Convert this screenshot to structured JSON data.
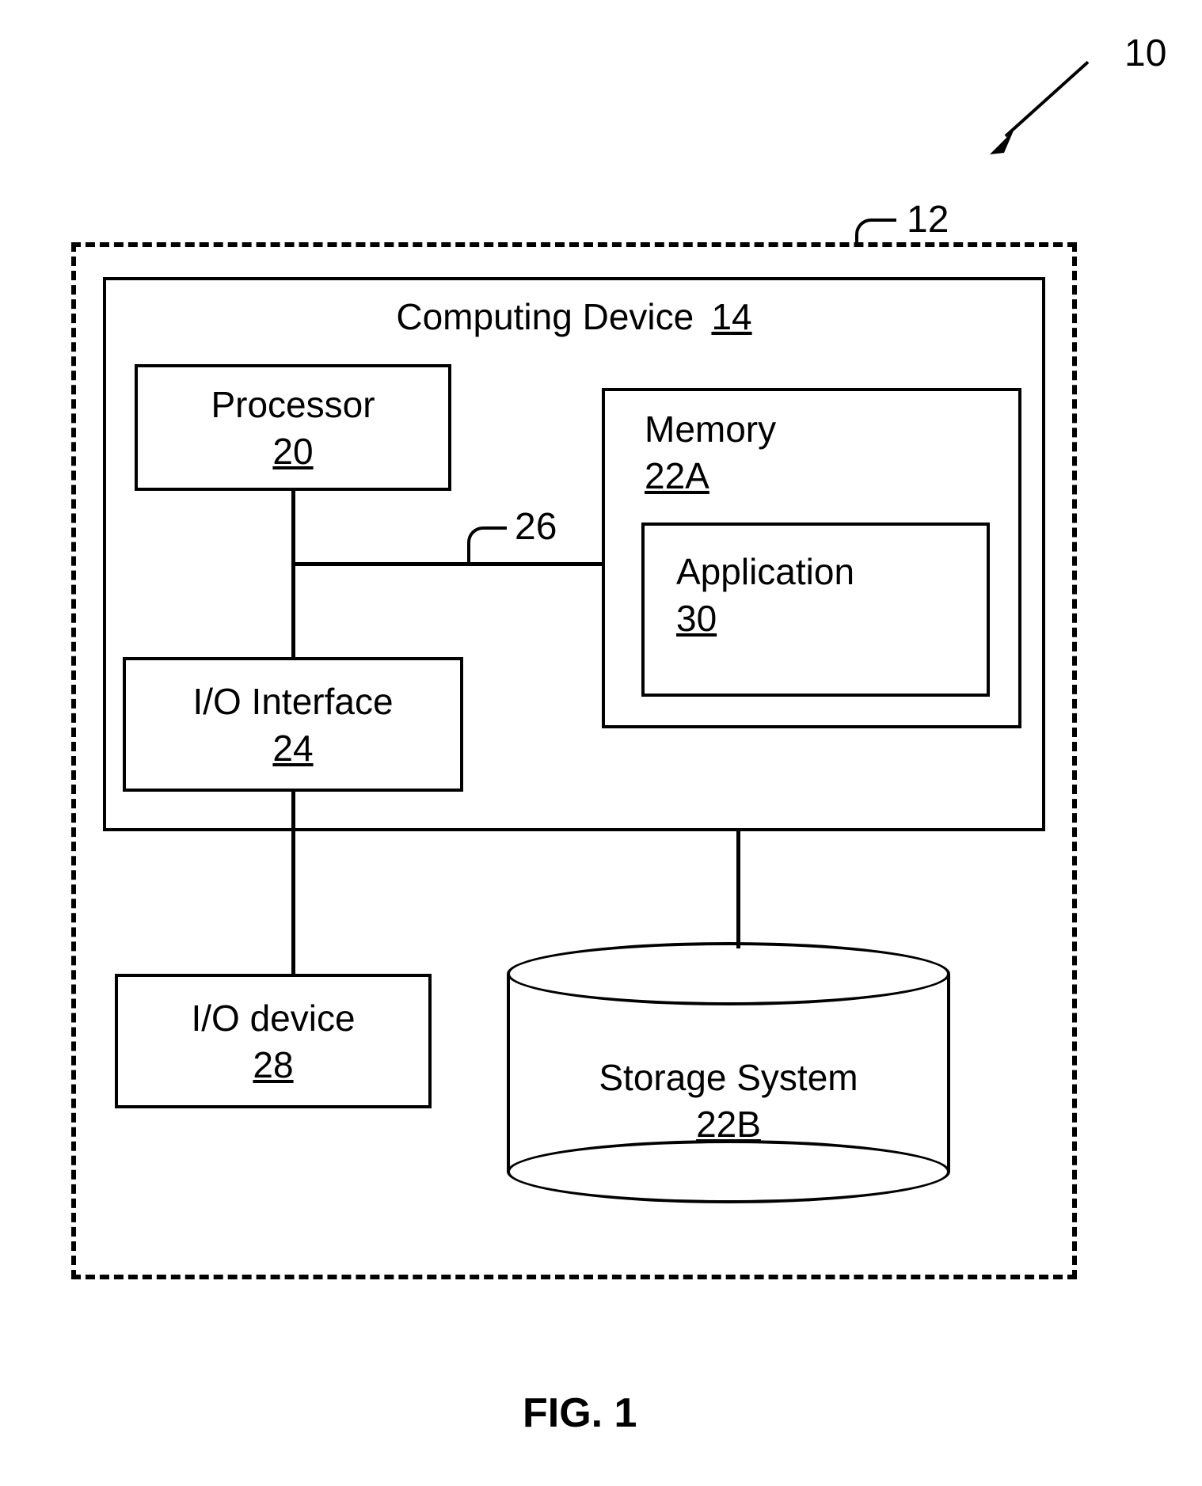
{
  "figure": {
    "title": "FIG. 1",
    "system_ref": "10",
    "server_ref": "12",
    "bus_ref": "26"
  },
  "blocks": {
    "computing_device": {
      "label": "Computing Device",
      "ref": "14"
    },
    "processor": {
      "label": "Processor",
      "ref": "20"
    },
    "memory": {
      "label": "Memory",
      "ref": "22A"
    },
    "application": {
      "label": "Application",
      "ref": "30"
    },
    "io_interface": {
      "label": "I/O Interface",
      "ref": "24"
    },
    "io_device": {
      "label": "I/O device",
      "ref": "28"
    },
    "storage": {
      "label": "Storage System",
      "ref": "22B"
    }
  }
}
